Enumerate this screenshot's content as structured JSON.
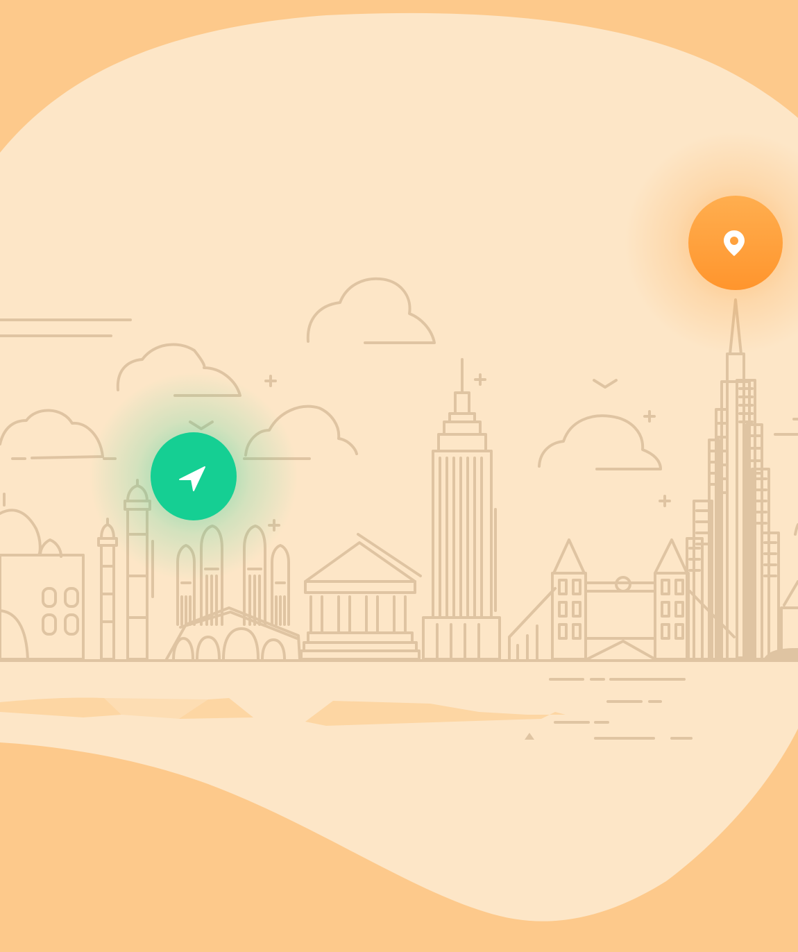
{
  "colors": {
    "background": "#FDC98B",
    "blob": "#FDE6C7",
    "line_art": "#DFC4A2",
    "reflection": "#FDD6A3",
    "nav_pin": "#15CF93",
    "nav_glow": "#15CF93",
    "location_pin_top": "#FFAE4F",
    "location_pin_bottom": "#FF952D",
    "location_glow": "#FF9A2E",
    "icon_fill": "#FFFFFF"
  },
  "markers": {
    "navigation": {
      "icon": "navigation-arrow-icon"
    },
    "destination": {
      "icon": "map-pin-icon"
    }
  }
}
